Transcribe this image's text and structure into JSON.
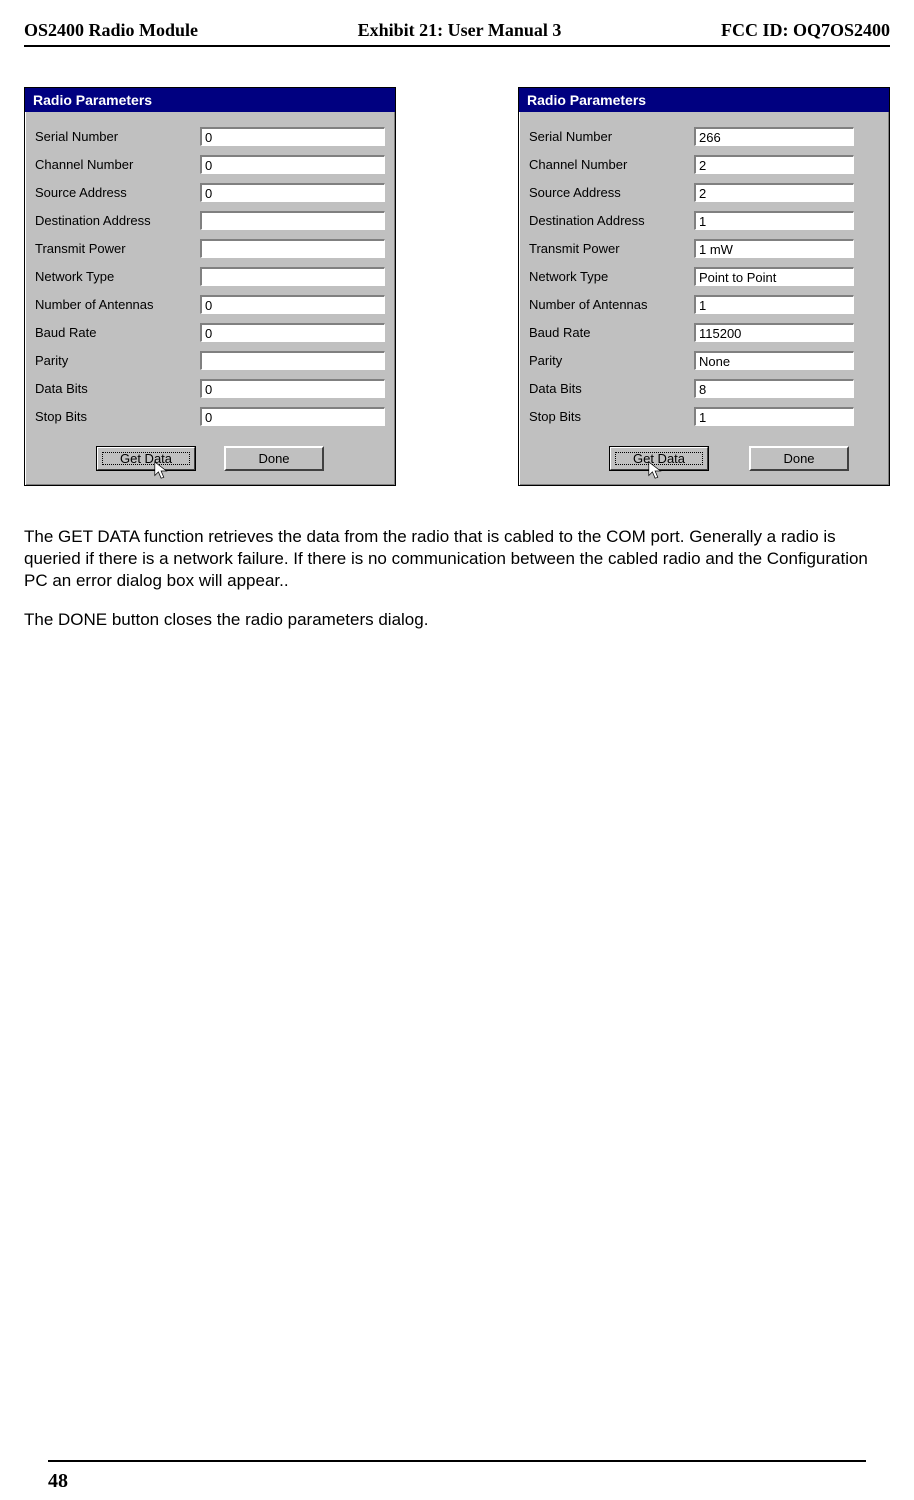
{
  "header": {
    "left": "OS2400 Radio Module",
    "center": "Exhibit 21: User Manual 3",
    "right": "FCC ID: OQ7OS2400"
  },
  "dialogs": {
    "title": "Radio Parameters",
    "labels": {
      "serial_number": "Serial Number",
      "channel_number": "Channel Number",
      "source_address": "Source Address",
      "destination_address": "Destination Address",
      "transmit_power": "Transmit Power",
      "network_type": "Network Type",
      "number_of_antennas": "Number of Antennas",
      "baud_rate": "Baud Rate",
      "parity": "Parity",
      "data_bits": "Data Bits",
      "stop_bits": "Stop Bits"
    },
    "left_values": {
      "serial_number": "0",
      "channel_number": "0",
      "source_address": "0",
      "destination_address": "",
      "transmit_power": "",
      "network_type": "",
      "number_of_antennas": "0",
      "baud_rate": "0",
      "parity": "",
      "data_bits": "0",
      "stop_bits": "0"
    },
    "right_values": {
      "serial_number": "266",
      "channel_number": "2",
      "source_address": "2",
      "destination_address": "1",
      "transmit_power": "1 mW",
      "network_type": "Point to Point",
      "number_of_antennas": "1",
      "baud_rate": "115200",
      "parity": "None",
      "data_bits": "8",
      "stop_bits": "1"
    },
    "buttons": {
      "get_data": "Get Data",
      "done": "Done"
    }
  },
  "paragraphs": {
    "p1": "The GET DATA function retrieves the data from the radio that is cabled to the COM port. Generally a radio is queried if there is a network failure.  If there is no communication between the cabled radio and the Configuration PC an error dialog box will appear..",
    "p2": "The DONE button closes the radio parameters dialog."
  },
  "page_number": "48"
}
